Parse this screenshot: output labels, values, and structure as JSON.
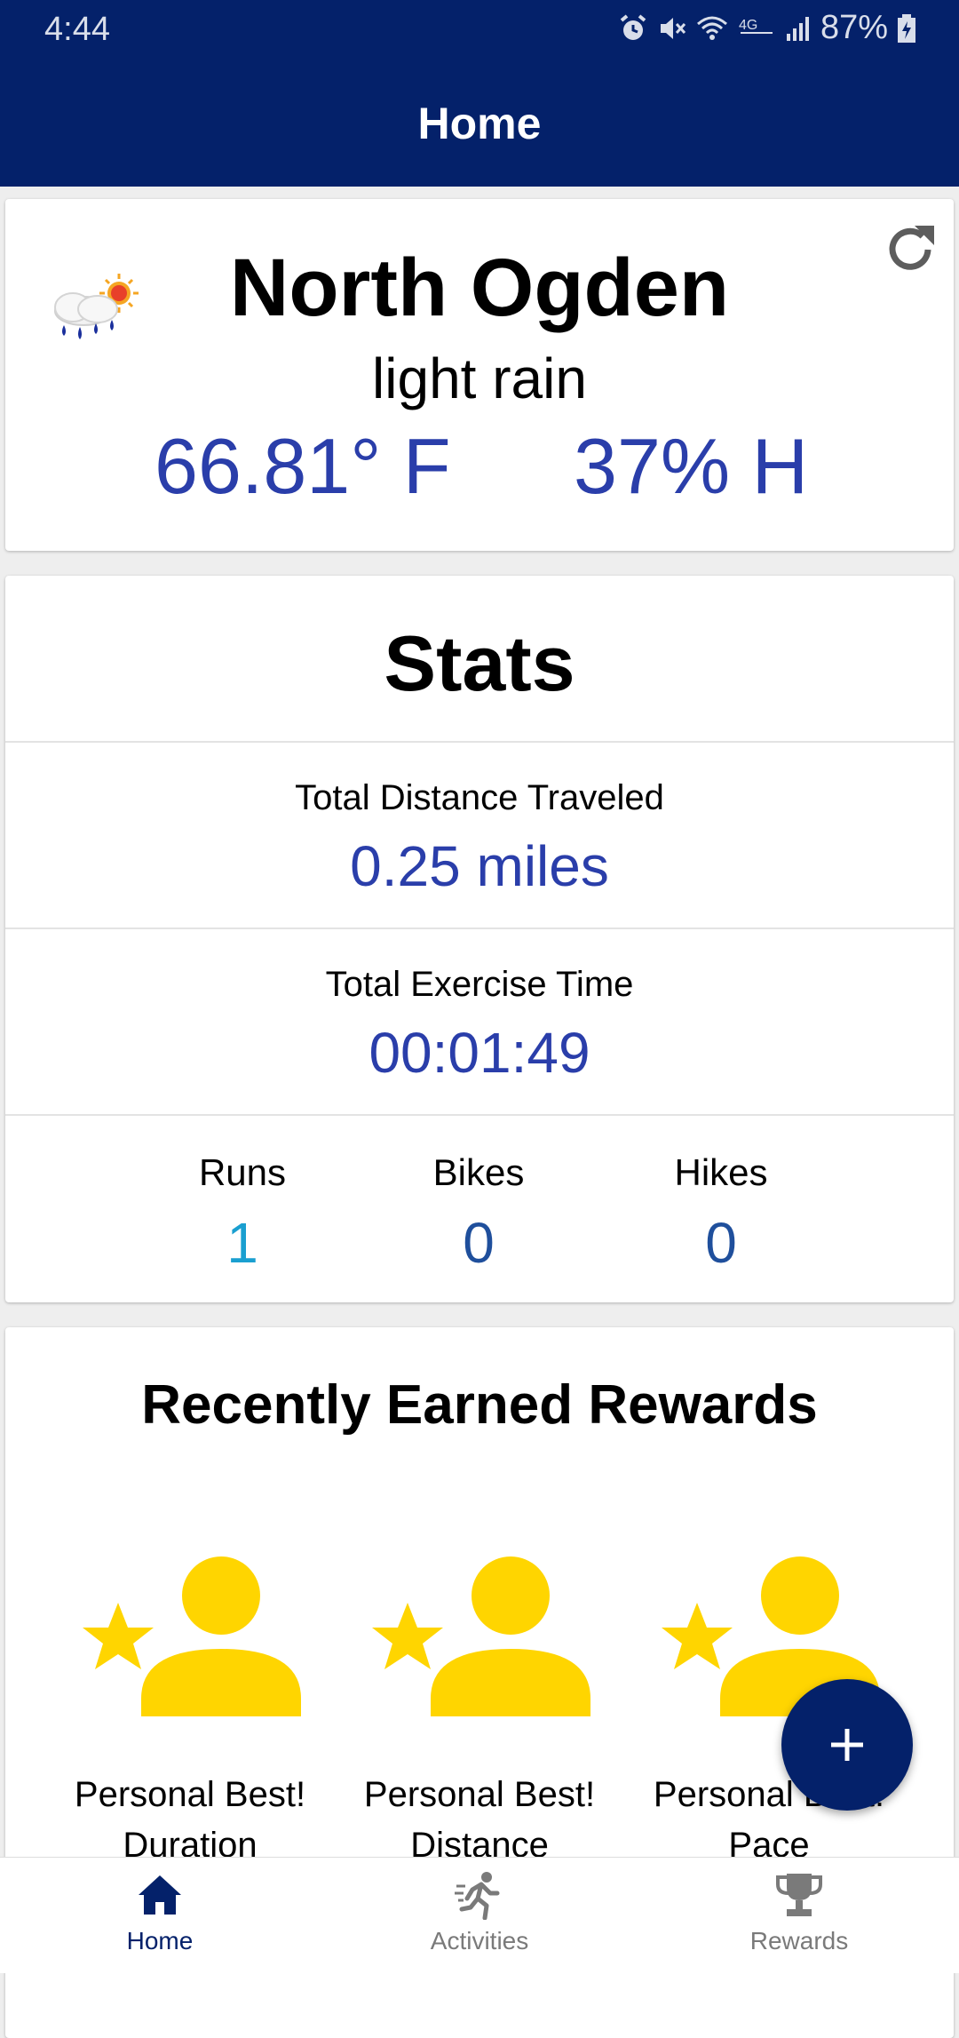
{
  "status_bar": {
    "time": "4:44",
    "battery": "87%"
  },
  "app_bar": {
    "title": "Home"
  },
  "weather": {
    "city": "North Ogden",
    "condition": "light rain",
    "temperature": "66.81° F",
    "humidity": "37% H",
    "icon": "rain-sun-icon"
  },
  "stats": {
    "title": "Stats",
    "distance_label": "Total Distance Traveled",
    "distance_value": "0.25 miles",
    "time_label": "Total Exercise Time",
    "time_value": "00:01:49",
    "counts": [
      {
        "label": "Runs",
        "value": "1"
      },
      {
        "label": "Bikes",
        "value": "0"
      },
      {
        "label": "Hikes",
        "value": "0"
      }
    ]
  },
  "rewards": {
    "title": "Recently Earned Rewards",
    "items": [
      {
        "line1": "Personal Best!",
        "line2": "Duration"
      },
      {
        "line1": "Personal Best!",
        "line2": "Distance"
      },
      {
        "line1": "Personal Best!",
        "line2": "Pace"
      }
    ]
  },
  "fab": {
    "icon": "plus-icon"
  },
  "bottom_nav": {
    "items": [
      {
        "label": "Home",
        "icon": "home-icon",
        "active": true
      },
      {
        "label": "Activities",
        "icon": "running-icon",
        "active": false
      },
      {
        "label": "Rewards",
        "icon": "trophy-icon",
        "active": false
      }
    ]
  },
  "colors": {
    "primary": "#04216a",
    "accent_blue": "#2a3eaa",
    "runs_value": "#1a9fd0",
    "counts_value": "#1f4f9c",
    "reward_yellow": "#ffd500",
    "nav_inactive": "#7a7a7a"
  }
}
